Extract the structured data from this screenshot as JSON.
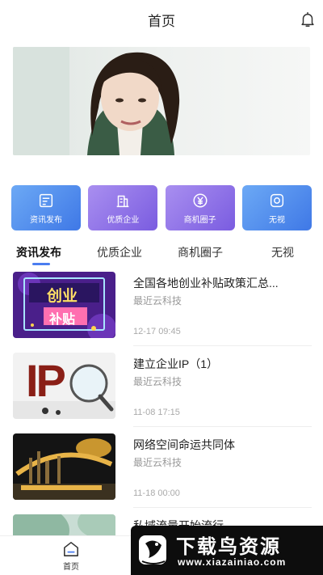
{
  "header": {
    "title": "首页",
    "bell_icon": "bell-icon"
  },
  "banner": {
    "content": "portrait video frame"
  },
  "quick_links": [
    {
      "label": "资讯发布",
      "icon": "document-icon"
    },
    {
      "label": "优质企业",
      "icon": "building-icon"
    },
    {
      "label": "商机圈子",
      "icon": "yen-circle-icon"
    },
    {
      "label": "无视",
      "icon": "circle-square-icon"
    }
  ],
  "tabs": [
    {
      "label": "资讯发布",
      "active": true
    },
    {
      "label": "优质企业",
      "active": false
    },
    {
      "label": "商机圈子",
      "active": false
    },
    {
      "label": "无视",
      "active": false
    }
  ],
  "articles": [
    {
      "title": "全国各地创业补贴政策汇总...",
      "source": "最近云科技",
      "time": "12-17 09:45",
      "thumb_text_1": "创业",
      "thumb_text_2": "补贴"
    },
    {
      "title": "建立企业IP（1）",
      "source": "最近云科技",
      "time": "11-08 17:15",
      "thumb_text_1": "IP"
    },
    {
      "title": "网络空间命运共同体",
      "source": "最近云科技",
      "time": "11-18 00:00"
    },
    {
      "title": "私域流量开始流行"
    }
  ],
  "bottom_nav": {
    "home_label": "首页"
  },
  "watermark": {
    "big_text": "下载鸟资源",
    "url": "www.xiazainiao.com"
  }
}
